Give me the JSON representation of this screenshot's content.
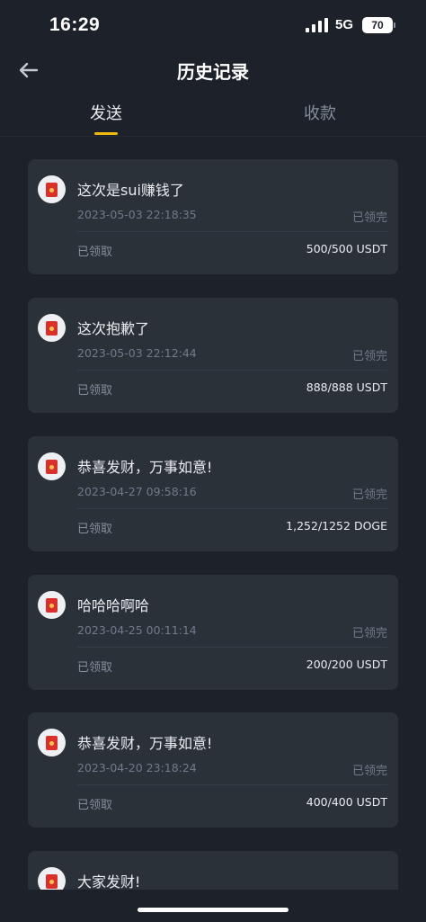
{
  "status_bar": {
    "time": "16:29",
    "network": "5G",
    "battery": "70"
  },
  "header": {
    "title": "历史记录"
  },
  "tabs": [
    {
      "label": "发送",
      "active": true
    },
    {
      "label": "收款",
      "active": false
    }
  ],
  "accent_color": "#f0b90b",
  "records": [
    {
      "title": "这次是sui赚钱了",
      "date": "2023-05-03 22:18:35",
      "status": "已领完",
      "label": "已领取",
      "amount": "500/500 USDT"
    },
    {
      "title": "这次抱歉了",
      "date": "2023-05-03 22:12:44",
      "status": "已领完",
      "label": "已领取",
      "amount": "888/888 USDT"
    },
    {
      "title": "恭喜发财，万事如意!",
      "date": "2023-04-27 09:58:16",
      "status": "已领完",
      "label": "已领取",
      "amount": "1,252/1252 DOGE"
    },
    {
      "title": "哈哈哈啊哈",
      "date": "2023-04-25 00:11:14",
      "status": "已领完",
      "label": "已领取",
      "amount": "200/200 USDT"
    },
    {
      "title": "恭喜发财，万事如意!",
      "date": "2023-04-20 23:18:24",
      "status": "已领完",
      "label": "已领取",
      "amount": "400/400 USDT"
    },
    {
      "title": "大家发财!",
      "date": "",
      "status": "",
      "label": "",
      "amount": ""
    }
  ]
}
